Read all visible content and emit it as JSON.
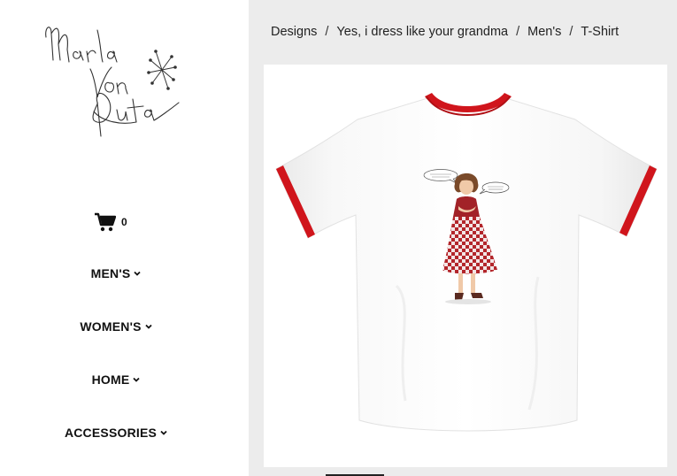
{
  "store": {
    "logo_text": "Marla Von Duta",
    "cart_count": "0"
  },
  "nav": [
    {
      "label": "MEN'S"
    },
    {
      "label": "WOMEN'S"
    },
    {
      "label": "HOME"
    },
    {
      "label": "ACCESSORIES"
    }
  ],
  "breadcrumb": [
    {
      "label": "Designs"
    },
    {
      "label": "Yes, i dress like your grandma"
    },
    {
      "label": "Men's"
    },
    {
      "label": "T-Shirt"
    }
  ],
  "breadcrumb_separator": "/",
  "product": {
    "shirt_color": "#ffffff",
    "trim_color": "#d0151c"
  },
  "icons": [
    "cart-icon",
    "chevron-down-icon",
    "logo-star-icon"
  ]
}
